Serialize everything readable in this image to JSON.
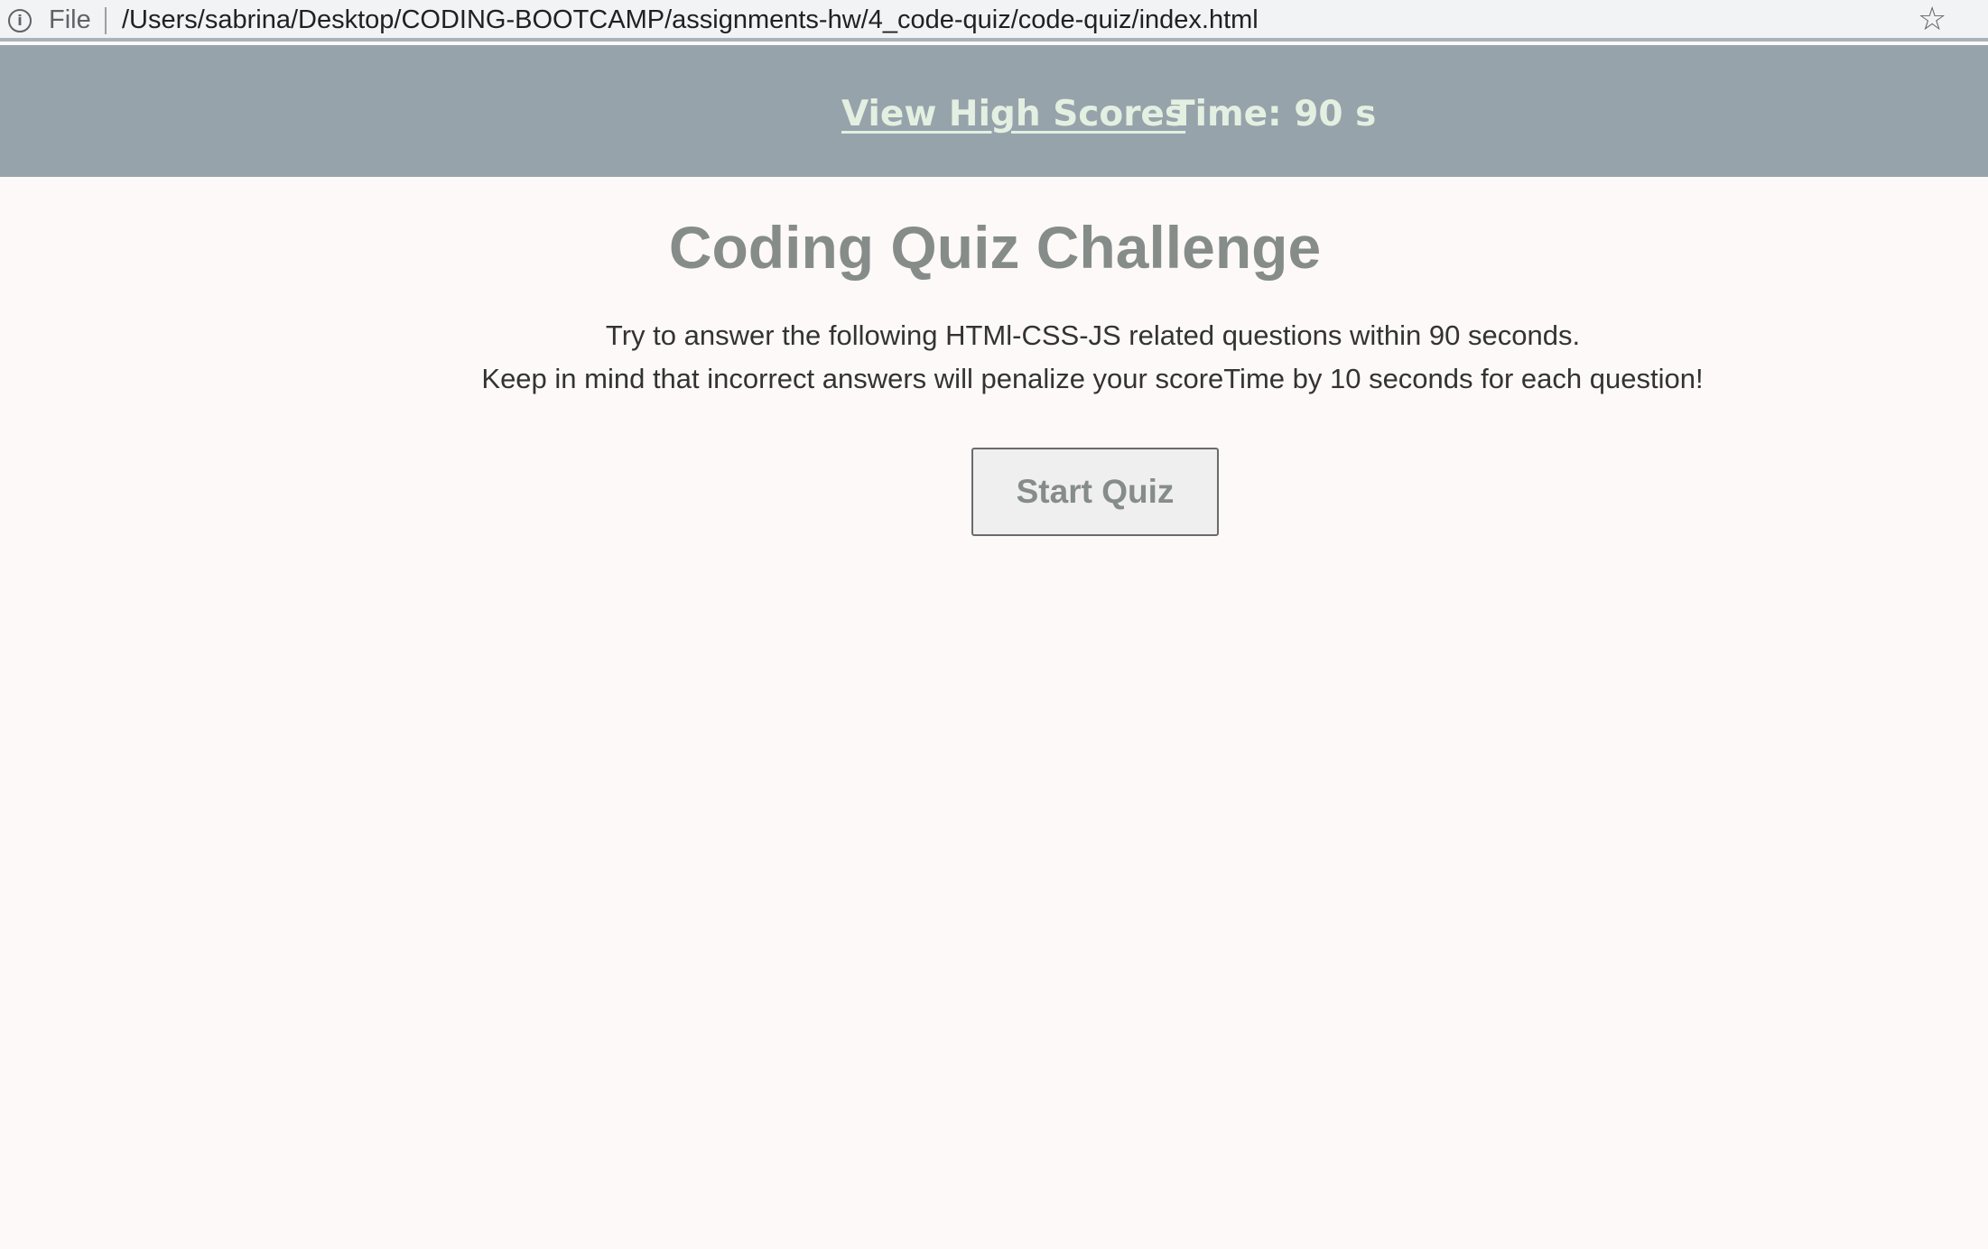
{
  "browser": {
    "file_label": "File",
    "url": "/Users/sabrina/Desktop/CODING-BOOTCAMP/assignments-hw/4_code-quiz/code-quiz/index.html",
    "info_icon": "info-icon",
    "bookmark_icon": "star-icon"
  },
  "header": {
    "high_scores_link": "View High Scores",
    "timer": "Time: 90 s"
  },
  "main": {
    "title": "Coding Quiz Challenge",
    "intro_line_1": "Try to answer the following HTMl-CSS-JS related questions within 90 seconds.",
    "intro_line_2": "Keep in mind that incorrect answers will penalize your scoreTime by 10 seconds for each question!",
    "start_button": "Start Quiz"
  },
  "colors": {
    "header_bg": "#96a3ab",
    "header_text": "#e3f0e1",
    "page_bg": "#fdf9f8",
    "title_text": "#858c8a",
    "body_text": "#333333",
    "button_bg": "#efefef"
  }
}
